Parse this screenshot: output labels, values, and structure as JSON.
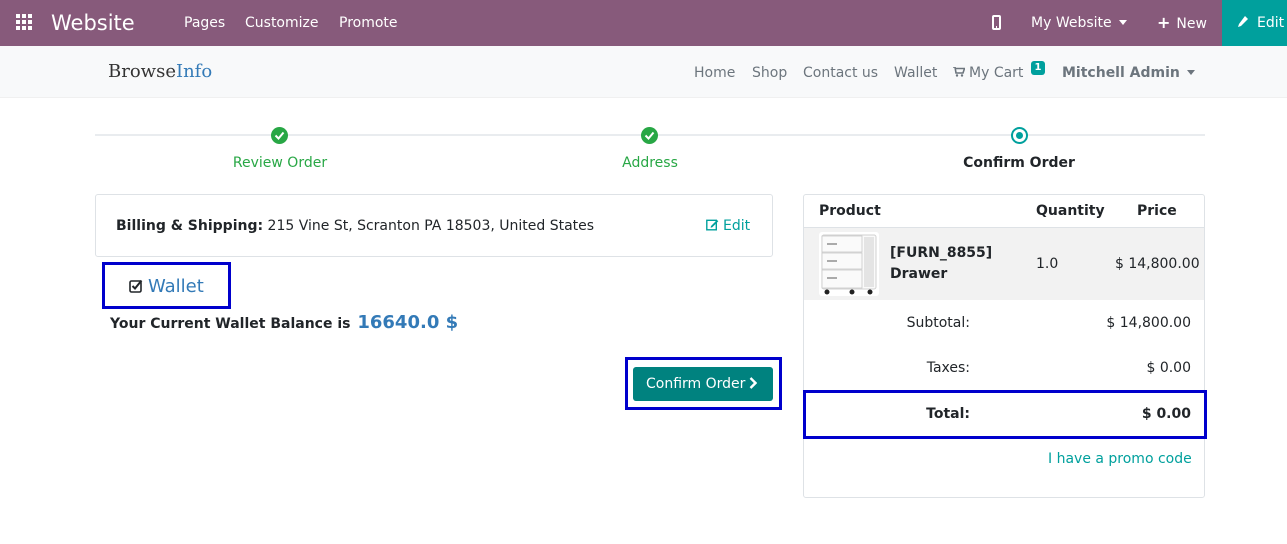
{
  "topbar": {
    "title": "Website",
    "menu": [
      "Pages",
      "Customize",
      "Promote"
    ],
    "site_selector": "My Website",
    "new_label": "New",
    "edit_label": "Edit",
    "color": "#875a7b",
    "edit_color": "#00a09d"
  },
  "navbar": {
    "logo_part1": "Browse",
    "logo_part2": "Info",
    "links": [
      "Home",
      "Shop",
      "Contact us",
      "Wallet"
    ],
    "cart_label": "My Cart",
    "cart_count": "1",
    "user": "Mitchell Admin"
  },
  "wizard": {
    "steps": [
      {
        "label": "Review Order",
        "state": "done"
      },
      {
        "label": "Address",
        "state": "done"
      },
      {
        "label": "Confirm Order",
        "state": "current"
      }
    ]
  },
  "billing": {
    "label": "Billing & Shipping:",
    "address": "215 Vine St, Scranton PA 18503, United States",
    "edit_label": "Edit"
  },
  "wallet": {
    "checkbox_label": "Wallet",
    "checked": true,
    "balance_text": "Your Current Wallet Balance is",
    "balance_amount": "16640.0 $"
  },
  "confirm_button": "Confirm Order",
  "summary": {
    "headers": [
      "Product",
      "Quantity",
      "Price"
    ],
    "items": [
      {
        "name_line1": "[FURN_8855]",
        "name_line2": "Drawer",
        "quantity": "1.0",
        "price": "$ 14,800.00",
        "icon": "drawer-product-image"
      }
    ],
    "subtotal_label": "Subtotal:",
    "subtotal": "$ 14,800.00",
    "taxes_label": "Taxes:",
    "taxes": "$ 0.00",
    "total_label": "Total:",
    "total": "$ 0.00",
    "promo_label": "I have a promo code"
  },
  "highlight_color": "#0000cc"
}
